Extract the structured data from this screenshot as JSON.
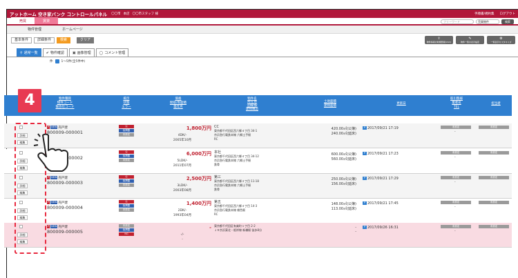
{
  "app": {
    "title": "アットホーム 空き家バンク コントロールパネル",
    "header_info_1": "〇〇市",
    "header_info_2": "本店",
    "header_info_3": "〇〇市スタッフ 様",
    "manual": "手順書/規約集",
    "logout": "ログアウト"
  },
  "main_tabs": [
    "売買",
    "賃貸"
  ],
  "search": {
    "placeholder": "フリーワード",
    "select_value": "売買物件",
    "button": "検索"
  },
  "subnav": [
    "物件管理",
    "ホームページ"
  ],
  "filters": {
    "basic": "基本条件",
    "detail": "詳細条件",
    "search": "検索",
    "clear": "クリア"
  },
  "actions": [
    "物件情報の新規登録(CSV)",
    "物件一覧の表示設定",
    "一覧表示カスタマイズ"
  ],
  "view_tabs": [
    "通常一覧",
    "物件確認",
    "画像管理",
    "コメント管理"
  ],
  "count": "件",
  "count_range": "1〜5件(全5件中)",
  "headers": {
    "col1": [
      "物件種目",
      "物件コード",
      "競合仕コード"
    ],
    "col2": [
      "掲示",
      "状態",
      "エラー"
    ],
    "col3": [
      "価格",
      "間取/専面積",
      "築年月"
    ],
    "col4": [
      "物件名",
      "所在地",
      "沿線/駅",
      "建物構造"
    ],
    "col5": [
      "土地面積",
      "建物面積"
    ],
    "col6": "更新日",
    "col7": [
      "取引態様",
      "業者名",
      "TEL"
    ],
    "col8": "担当者"
  },
  "step_number": "4",
  "row_buttons": {
    "detail": "詳細",
    "edit": "編集"
  },
  "rows": [
    {
      "type": "売戸建",
      "code": "800009-000001",
      "status": [
        "公",
        "仮掲載",
        "未設定"
      ],
      "price": "1,800万円",
      "layout": "4DK/-",
      "built": "2005年10月",
      "name": "CC",
      "address": "東京都千代田区西六郷４丁目 34-1",
      "station": "京浜急行電鉄本線 六郷土手駅",
      "structure": "RC",
      "land": "420.00㎡(公簿)",
      "building": "240.00㎡(延床)",
      "updated": "2017/09/21 17:19",
      "deal": "未設定",
      "staff": "未設定"
    },
    {
      "type": "売戸建",
      "code": "800009-000002",
      "status": [
        "公",
        "仮掲載",
        "未設定"
      ],
      "price": "6,000万円",
      "layout": "5LDK/-",
      "built": "2011年07月",
      "name": "本社",
      "address": "東京都千代田区西六郷４丁目 34-12",
      "station": "京浜急行電鉄本線 六郷土手駅",
      "structure": "鉄骨",
      "land": "600.00㎡(公簿)",
      "building": "560.00㎡(延床)",
      "updated": "2017/09/21 17:23",
      "deal": "未設定",
      "staff": "未設定"
    },
    {
      "type": "売戸建",
      "code": "800009-000003",
      "status": [
        "公",
        "仮掲載",
        "未設定"
      ],
      "price": "2,500万円",
      "layout": "3LDK/-",
      "built": "2003年08月",
      "name": "第三",
      "address": "東京都千代田区西六郷３丁目 11-18",
      "station": "京浜急行電鉄本線 六郷土手駅",
      "structure": "鉄骨",
      "land": "250.00㎡(公簿)",
      "building": "156.00㎡(延床)",
      "updated": "2017/09/21 17:29",
      "deal": "未設定",
      "staff": "未設定"
    },
    {
      "type": "売戸建",
      "code": "800009-000004",
      "status": [
        "公",
        "仮掲載",
        "未設定"
      ],
      "price": "1,400万円",
      "layout": "2DK/-",
      "built": "1993年04月",
      "name": "第五",
      "address": "東京都千代田区西六郷４丁目 14-3",
      "station": "京浜急行電鉄本線 雑色駅",
      "structure": "RC",
      "land": "148.00㎡(公簿)",
      "building": "113.00㎡(延床)",
      "updated": "2017/09/21 17:45",
      "deal": "未設定",
      "staff": "未設定"
    },
    {
      "type": "売戸建",
      "code": "800009-000005",
      "status": [
        "未設定",
        "仮掲載",
        "NG"
      ],
      "price": "-",
      "layout": "-/-",
      "built": "-",
      "name": "",
      "address": "東京都千代田区有楽町１丁目 2-2",
      "station": "ＪＲ京浜東北・根岸線 新橋駅 徒歩8分",
      "structure": "",
      "land": "-",
      "building": "-",
      "updated": "2017/09/26 16:31",
      "deal": "未設定",
      "staff": "未設定"
    }
  ],
  "colors": {
    "brand": "#b1173a",
    "accent": "#2f7fd0",
    "step": "#e83a52",
    "price": "#c0202f"
  }
}
